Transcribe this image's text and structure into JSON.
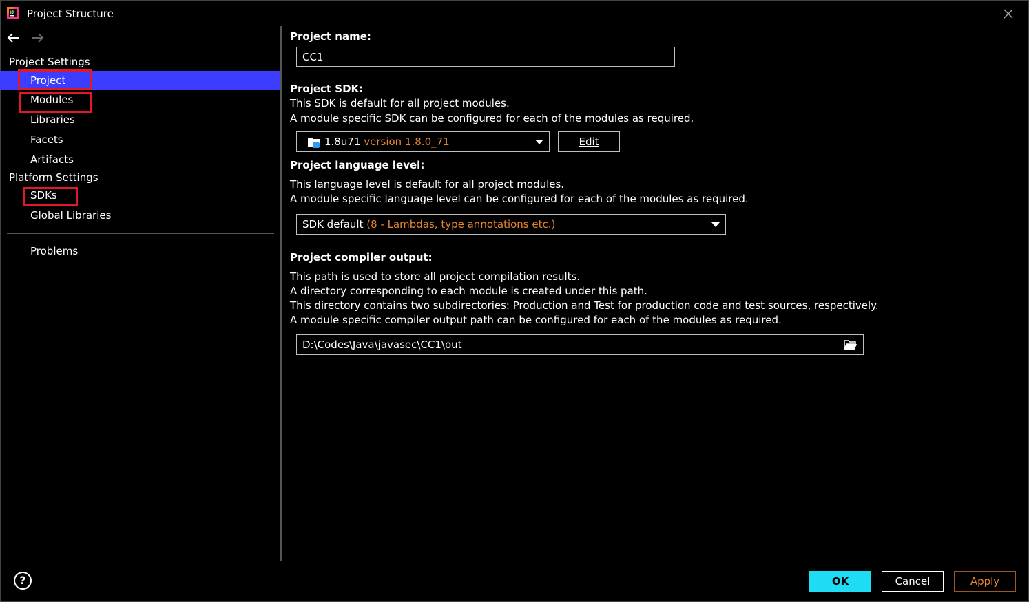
{
  "window": {
    "title": "Project Structure"
  },
  "nav": {
    "project_settings_label": "Project Settings",
    "platform_settings_label": "Platform Settings",
    "items": [
      {
        "label": "Project",
        "selected": true,
        "highlighted": true
      },
      {
        "label": "Modules",
        "highlighted": true
      },
      {
        "label": "Libraries"
      },
      {
        "label": "Facets"
      },
      {
        "label": "Artifacts"
      },
      {
        "label": "SDKs",
        "highlighted": true
      },
      {
        "label": "Global Libraries"
      },
      {
        "label": "Problems"
      }
    ]
  },
  "project": {
    "name_label": "Project name:",
    "name_value": "CC1",
    "sdk_label": "Project SDK:",
    "sdk_desc1": "This SDK is default for all project modules.",
    "sdk_desc2": "A module specific SDK can be configured for each of the modules as required.",
    "sdk_name": "1.8u71",
    "sdk_version": "version 1.8.0_71",
    "sdk_edit_label": "Edit",
    "lang_label": "Project language level:",
    "lang_desc1": "This language level is default for all project modules.",
    "lang_desc2": "A module specific language level can be configured for each of the modules as required.",
    "lang_value": "SDK default",
    "lang_detail": "(8 - Lambdas, type annotations etc.)",
    "output_label": "Project compiler output:",
    "output_desc1": "This path is used to store all project compilation results.",
    "output_desc2": "A directory corresponding to each module is created under this path.",
    "output_desc3": "This directory contains two subdirectories: Production and Test for production code and test sources, respectively.",
    "output_desc4": "A module specific compiler output path can be configured for each of the modules as required.",
    "output_path": "D:\\Codes\\Java\\javasec\\CC1\\out"
  },
  "footer": {
    "help_label": "?",
    "ok_label": "OK",
    "cancel_label": "Cancel",
    "apply_label": "Apply"
  },
  "colors": {
    "selection": "#3d3dff",
    "highlight_box": "#e0182a",
    "accent_text": "#e8862e",
    "ok_button": "#1fdcf5"
  },
  "icons": [
    "intellij-app-icon",
    "close-icon",
    "back-arrow-icon",
    "forward-arrow-icon",
    "sdk-folder-icon",
    "dropdown-arrow-icon",
    "folder-open-icon",
    "help-icon"
  ]
}
